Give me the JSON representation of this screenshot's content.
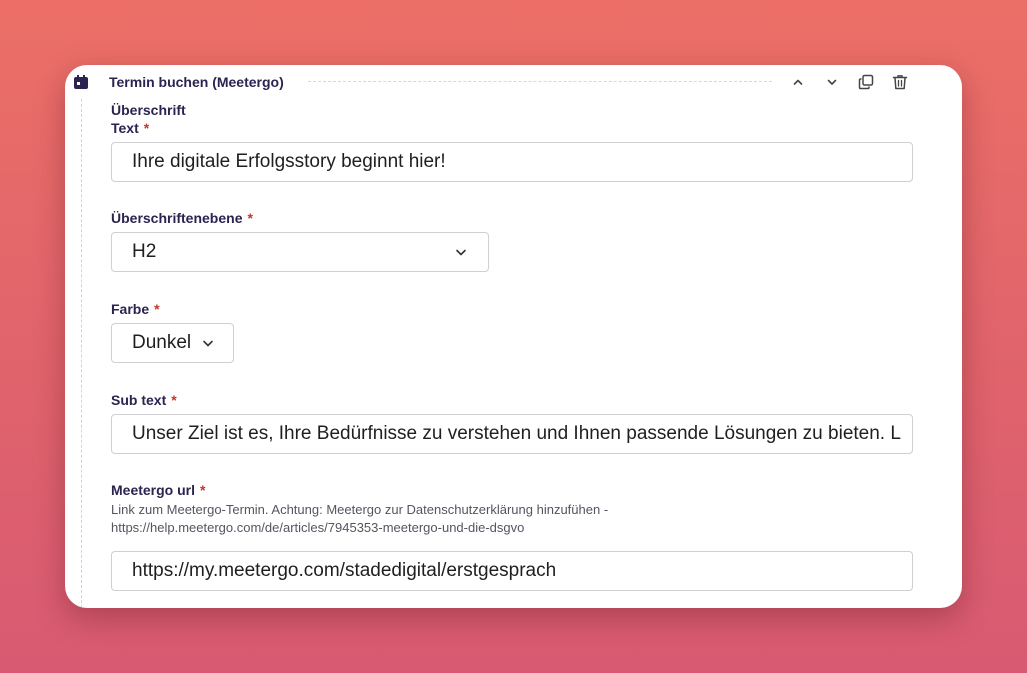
{
  "block": {
    "title": "Termin buchen (Meetergo)",
    "icons": {
      "block": "calendar-icon",
      "move_up": "chevron-up-icon",
      "move_down": "chevron-down-icon",
      "duplicate": "copy-icon",
      "delete": "trash-icon"
    }
  },
  "heading_group": {
    "title": "Überschrift"
  },
  "fields": {
    "text": {
      "label": "Text",
      "required_mark": "*",
      "value": "Ihre digitale Erfolgsstory beginnt hier!"
    },
    "heading_level": {
      "label": "Überschriftenebene",
      "required_mark": "*",
      "value": "H2"
    },
    "color": {
      "label": "Farbe",
      "required_mark": "*",
      "value": "Dunkel"
    },
    "sub_text": {
      "label": "Sub text",
      "required_mark": "*",
      "value": "Unser Ziel ist es, Ihre Bedürfnisse zu verstehen und Ihnen passende Lösungen zu bieten. L"
    },
    "meetergo_url": {
      "label": "Meetergo url",
      "required_mark": "*",
      "hint": "Link zum Meetergo-Termin. Achtung: Meetergo zur Datenschutzerklärung hinzufühen - https://help.meetergo.com/de/articles/7945353-meetergo-und-die-dsgvo",
      "value": "https://my.meetergo.com/stadedigital/erstgesprach"
    }
  }
}
